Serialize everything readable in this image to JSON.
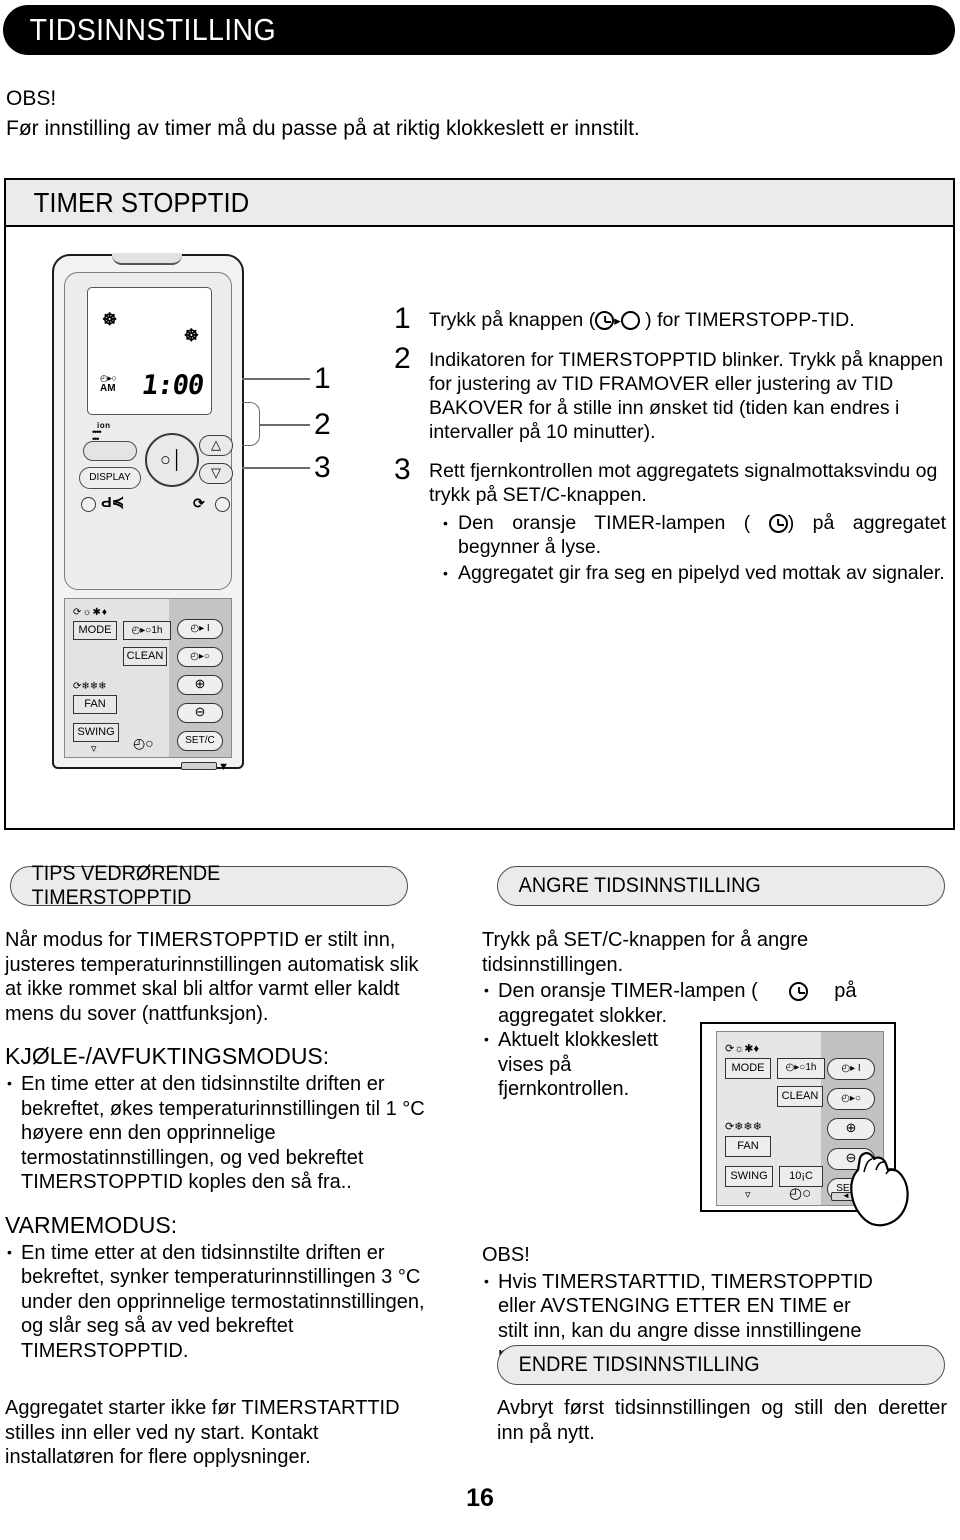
{
  "header": {
    "title": "TIDSINNSTILLING"
  },
  "obs": {
    "label": "OBS!",
    "text": "Før innstilling av timer må du passe på at riktig klokkeslett er innstilt."
  },
  "timer_section": {
    "header": "TIMER STOPPTID",
    "remote": {
      "lcd": {
        "timer_icon": "◴▸○",
        "am": "AM",
        "time": "1:00",
        "swirl": "☸"
      },
      "buttons": {
        "ion_label": "ion",
        "display": "DISPLAY",
        "mode": "MODE",
        "one_hour": "◴▸○1h",
        "clean": "CLEAN",
        "fan": "FAN",
        "swing": "SWING",
        "timer_on": "◴▸ I",
        "timer_off": "◴▸○",
        "plus": "⊕",
        "minus": "⊖",
        "setc": "SET/C"
      }
    },
    "callouts": [
      "1",
      "2",
      "3"
    ],
    "steps": [
      {
        "num": "1",
        "text_before": "Trykk  på  knappen  (",
        "text_after": " )  for  TIMERSTOPP-TID.",
        "bullets": []
      },
      {
        "num": "2",
        "text": "Indikatoren for TIMERSTOPPTID blinker. Trykk på knappen for justering av TID FRAMOVER eller justering av TID BAKOVER for å stille inn ønsket tid (tiden kan endres i intervaller på 10 minutter).",
        "bullets": []
      },
      {
        "num": "3",
        "text": "Rett fjernkontrollen mot aggregatets signalmottaksvindu og trykk på SET/C-knappen.",
        "bullets": [
          {
            "before": "Den  oransje  TIMER-lampen  (",
            "after": ")  på  aggregatet begynner å lyse."
          },
          {
            "before": "",
            "after": "Aggregatet  gir  fra  seg  en  pipelyd  ved  mottak  av signaler."
          }
        ]
      }
    ]
  },
  "tips": {
    "pill": "TIPS VEDRØRENDE TIMERSTOPPTID",
    "intro": "Når modus for TIMERSTOPPTID er stilt inn, justeres temperaturinnstillingen automatisk slik at ikke rommet skal bli altfor varmt eller kaldt mens du sover (nattfunksjon).",
    "cool_heading": "KJØLE-/AVFUKTINGSMODUS:",
    "cool_bullet": "En time etter at den tidsinnstilte driften er bekreftet, økes temperaturinnstillingen til 1 °C høyere enn den opprinnelige termostatinnstillingen, og ved bekreftet TIMERSTOPPTID koples den så fra..",
    "heat_heading": "VARMEMODUS:",
    "heat_bullet": "En time etter at den tidsinnstilte driften er bekreftet, synker temperaturinnstillingen 3 °C under den opprinnelige termostatinnstillingen, og slår seg så av ved bekreftet TIMERSTOPPTID.",
    "tail": "Aggregatet starter ikke før TIMERSTARTTID stilles inn eller ved ny start. Kontakt installatøren for flere opplysninger."
  },
  "angre": {
    "pill": "ANGRE TIDSINNSTILLING",
    "intro": "Trykk på SET/C-knappen for å angre tidsinnstillingen.",
    "bullet1_before": "Den oransje TIMER-lampen (",
    "bullet1_after": "på aggregatet slokker.",
    "bullet2": "Aktuelt klokkeslett vises på fjernkontrollen.",
    "obs_label": "OBS!",
    "obs_bullet": "Hvis TIMERSTARTTID, TIMERSTOPPTID eller AVSTENGING ETTER EN TIME er stilt inn, kan du angre disse innstillingene med SET/C-knappen.",
    "remote": {
      "mode": "MODE",
      "one_hour": "◴▸○1h",
      "clean": "CLEAN",
      "fan": "FAN",
      "swing": "SWING",
      "temp": "10¡C",
      "timer_on": "◴▸ I",
      "timer_off": "◴▸○",
      "plus": "⊕",
      "minus": "⊖",
      "setc": "SET/C"
    }
  },
  "endre": {
    "pill": "ENDRE TIDSINNSTILLING",
    "text": "Avbryt først tidsinnstillingen og still den deretter inn på nytt."
  },
  "page_number": "16",
  "colors": {
    "header_bg": "#000000",
    "header_text": "#ffffff",
    "panel_gray": "#ebebeb",
    "remote_body": "#f2f2f2",
    "remote_dark": "#c4c4c4"
  }
}
